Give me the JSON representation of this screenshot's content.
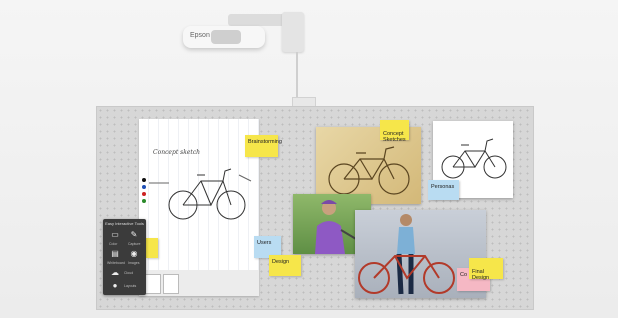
{
  "projector": {
    "brand": "Epson"
  },
  "canvas": {
    "sketch_caption": "Concept sketch"
  },
  "stickies": {
    "brainstorming": "Brainstorming",
    "concept_sketches": "Concept\nSketches",
    "personas": "Personas",
    "users": "Users",
    "design": "Design",
    "final_design": "Final\nDesign",
    "compare": "Co"
  },
  "panel": {
    "title": "Easy Interactive Tools",
    "items": [
      "Color",
      "Capture",
      "Whiteboard",
      "Images",
      "Cloud",
      "Layouts"
    ]
  },
  "colors": {
    "sticky_yellow": "#f6e64a",
    "sticky_blue": "#b9dcf2",
    "sticky_pink": "#f5b8c4",
    "pen_colors": [
      "#111111",
      "#1e4fb5",
      "#c22",
      "#2a8a2a"
    ]
  }
}
